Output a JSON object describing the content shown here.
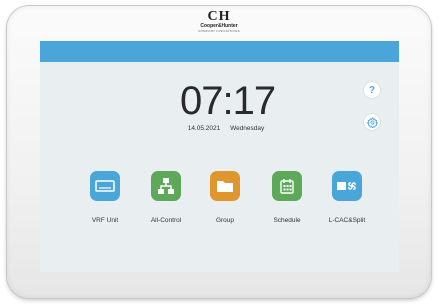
{
  "brand": {
    "mark": "CH",
    "name": "Cooper&Hunter",
    "tagline": "COMFORT INNOVATIONS"
  },
  "clock": {
    "time": "07:17",
    "date": "14.05.2021",
    "weekday": "Wednesday"
  },
  "side_buttons": {
    "help_label": "?"
  },
  "apps": [
    {
      "label": "VRF Unit",
      "icon": "vrf-unit-icon",
      "color": "#4aa6d8"
    },
    {
      "label": "All-Control",
      "icon": "all-control-icon",
      "color": "#5ea85a"
    },
    {
      "label": "Group",
      "icon": "group-folder-icon",
      "color": "#e0962f"
    },
    {
      "label": "Schedule",
      "icon": "schedule-calendar-icon",
      "color": "#5ea85a"
    },
    {
      "label": "L-CAC&Split",
      "icon": "l-cac-split-icon",
      "color": "#4aa6d8"
    }
  ],
  "colors": {
    "topbar": "#4aa6d8",
    "screen": "#e9eef0",
    "bezel": "#f3f3f3"
  }
}
